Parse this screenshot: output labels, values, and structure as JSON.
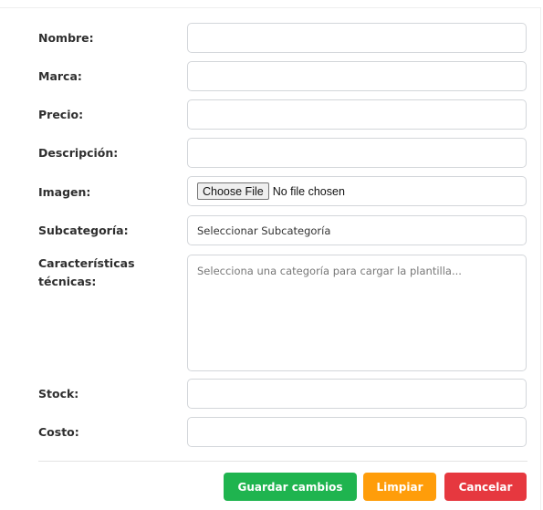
{
  "form": {
    "fields": {
      "nombre": {
        "label": "Nombre:",
        "value": ""
      },
      "marca": {
        "label": "Marca:",
        "value": ""
      },
      "precio": {
        "label": "Precio:",
        "value": ""
      },
      "descripcion": {
        "label": "Descripción:",
        "value": ""
      },
      "imagen": {
        "label": "Imagen:",
        "button_label": "Choose File",
        "status": "No file chosen"
      },
      "subcategoria": {
        "label": "Subcategoría:",
        "selected": "Seleccionar Subcategoría"
      },
      "caracteristicas": {
        "label_line1": "Características",
        "label_line2": "técnicas:",
        "placeholder": "Selecciona una categoría para cargar la plantilla..."
      },
      "stock": {
        "label": "Stock:",
        "value": ""
      },
      "costo": {
        "label": "Costo:",
        "value": ""
      }
    },
    "buttons": {
      "save": "Guardar cambios",
      "clear": "Limpiar",
      "cancel": "Cancelar"
    }
  },
  "colors": {
    "save": "#1fb44f",
    "clear": "#ff9d0a",
    "cancel": "#e6383f"
  }
}
